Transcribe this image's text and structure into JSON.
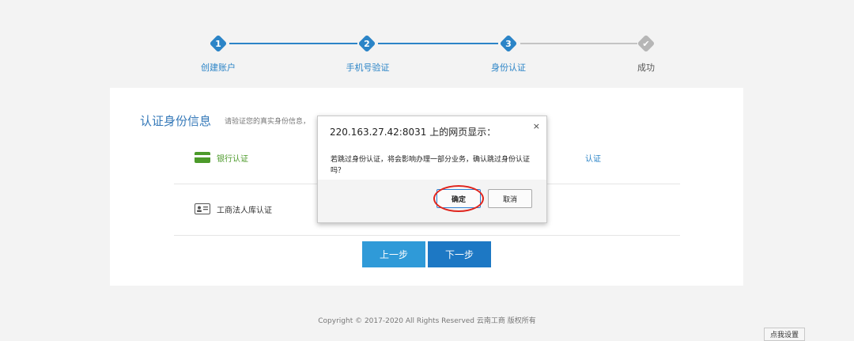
{
  "steps": [
    {
      "number": "1",
      "label": "创建账户"
    },
    {
      "number": "2",
      "label": "手机号验证"
    },
    {
      "number": "3",
      "label": "身份认证"
    },
    {
      "number": "✔",
      "label": "成功"
    }
  ],
  "card": {
    "title": "认证身份信息",
    "subtitle": "请验证您的真实身份信息，",
    "options": [
      {
        "label": "银行认证",
        "icon": "bank-card-icon",
        "action": "认证"
      },
      {
        "label": "工商法人库认证",
        "icon": "id-card-icon",
        "action": ""
      }
    ],
    "prev_button": "上一步",
    "next_button": "下一步"
  },
  "footer": {
    "copyright": "Copyright © 2017-2020 All Rights Reserved 云南工商 版权所有",
    "settings_button": "点我设置"
  },
  "dialog": {
    "title": "220.163.27.42:8031 上的网页显示：",
    "close": "×",
    "message": "若跳过身份认证，将会影响办理一部分业务，确认跳过身份认证吗？",
    "ok": "确定",
    "cancel": "取消"
  },
  "colors": {
    "accent": "#2b84c7",
    "step_done": "#b6b6b6",
    "bank_green": "#4c9a2a",
    "highlight_ring": "#e0241c"
  }
}
